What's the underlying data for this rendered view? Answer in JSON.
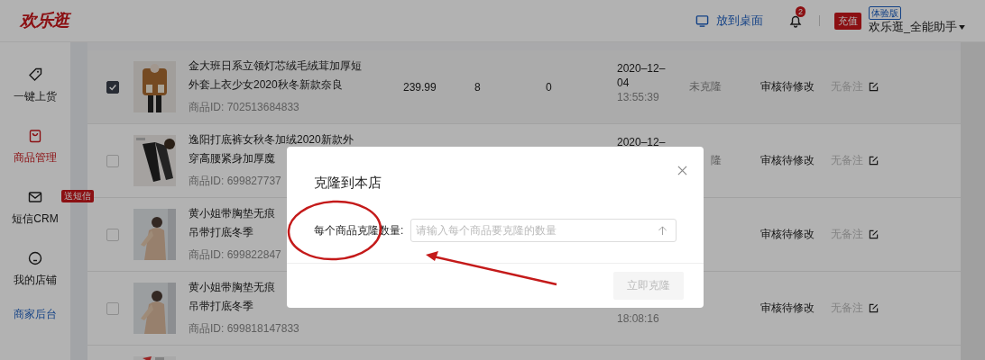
{
  "header": {
    "logo": "欢乐逛",
    "desktop_link": "放到桌面",
    "notification_count": "2",
    "recharge": "充值",
    "plan": "体验版",
    "account": "欢乐逛_全能助手"
  },
  "sidebar": {
    "items": [
      {
        "label": "一键上货",
        "selected": false
      },
      {
        "label": "商品管理",
        "selected": true
      },
      {
        "label": "短信CRM",
        "selected": false,
        "badge": "送短信"
      },
      {
        "label": "我的店铺",
        "selected": false
      }
    ],
    "footer_link": "商家后台"
  },
  "rows": [
    {
      "checked": true,
      "title": [
        "金大班日系立领灯芯绒毛绒茸加厚短",
        "外套上衣少女2020秋冬新款奈良"
      ],
      "product_id": "商品ID: 702513684833",
      "price": "239.99",
      "stock": "8",
      "sales": "0",
      "date": [
        "2020–12–",
        "04"
      ],
      "time": "13:55:39",
      "clone_status": "未克隆",
      "review_status": "审核待修改",
      "remark": "无备注"
    },
    {
      "checked": false,
      "title": [
        "逸阳打底裤女秋冬加绒2020新款外",
        "穿高腰紧身加厚魔"
      ],
      "product_id": "商品ID: 699827737",
      "date": [
        "2020–12–"
      ],
      "clone_status": "隆",
      "review_status": "审核待修改",
      "remark": "无备注"
    },
    {
      "checked": false,
      "title": [
        "黄小姐带胸垫无痕",
        "吊带打底冬季"
      ],
      "product_id": "商品ID: 699822847",
      "review_status": "审核待修改",
      "remark": "无备注"
    },
    {
      "checked": false,
      "title": [
        "黄小姐带胸垫无痕",
        "吊带打底冬季"
      ],
      "product_id": "商品ID: 699818147833",
      "time": "18:08:16",
      "review_status": "审核待修改",
      "remark": "无备注"
    }
  ],
  "dialog": {
    "title": "克隆到本店",
    "field_label": "每个商品克隆数量:",
    "placeholder": "请输入每个商品要克隆的数量",
    "submit": "立即克隆",
    "submit_disabled": true
  }
}
